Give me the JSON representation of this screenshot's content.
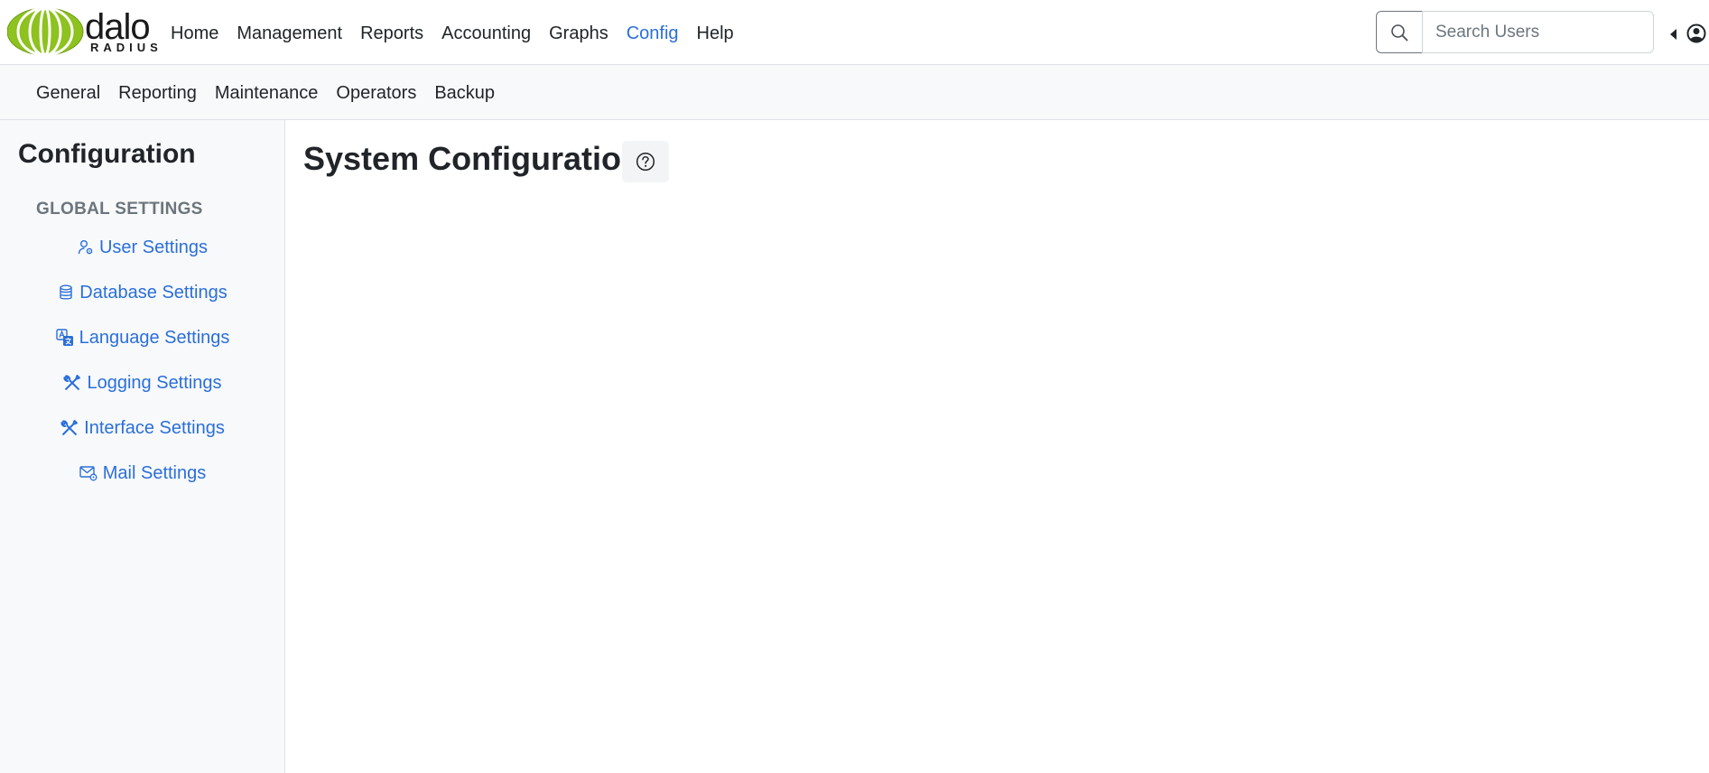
{
  "brand": {
    "word": "dalo",
    "sub": "RADIUS"
  },
  "main_menu": [
    "Home",
    "Management",
    "Reports",
    "Accounting",
    "Graphs",
    "Config",
    "Help"
  ],
  "active_menu": "Config",
  "search": {
    "placeholder": "Search Users",
    "value": ""
  },
  "sub_menu": [
    "General",
    "Reporting",
    "Maintenance",
    "Operators",
    "Backup"
  ],
  "sidebar": {
    "title": "Configuration",
    "section_heading": "GLOBAL SETTINGS",
    "items": [
      {
        "label": "User Settings",
        "icon": "user-gear-icon"
      },
      {
        "label": "Database Settings",
        "icon": "database-icon"
      },
      {
        "label": "Language Settings",
        "icon": "translate-icon"
      },
      {
        "label": "Logging Settings",
        "icon": "tools-icon"
      },
      {
        "label": "Interface Settings",
        "icon": "tools-icon"
      },
      {
        "label": "Mail Settings",
        "icon": "envelope-gear-icon"
      }
    ]
  },
  "page": {
    "title": "System Configuration",
    "help_icon": "question-circle-icon"
  },
  "colors": {
    "accent": "#2a6fdb",
    "logo_green": "#8dc21f",
    "sidebar_bg": "#f8f9fa"
  }
}
